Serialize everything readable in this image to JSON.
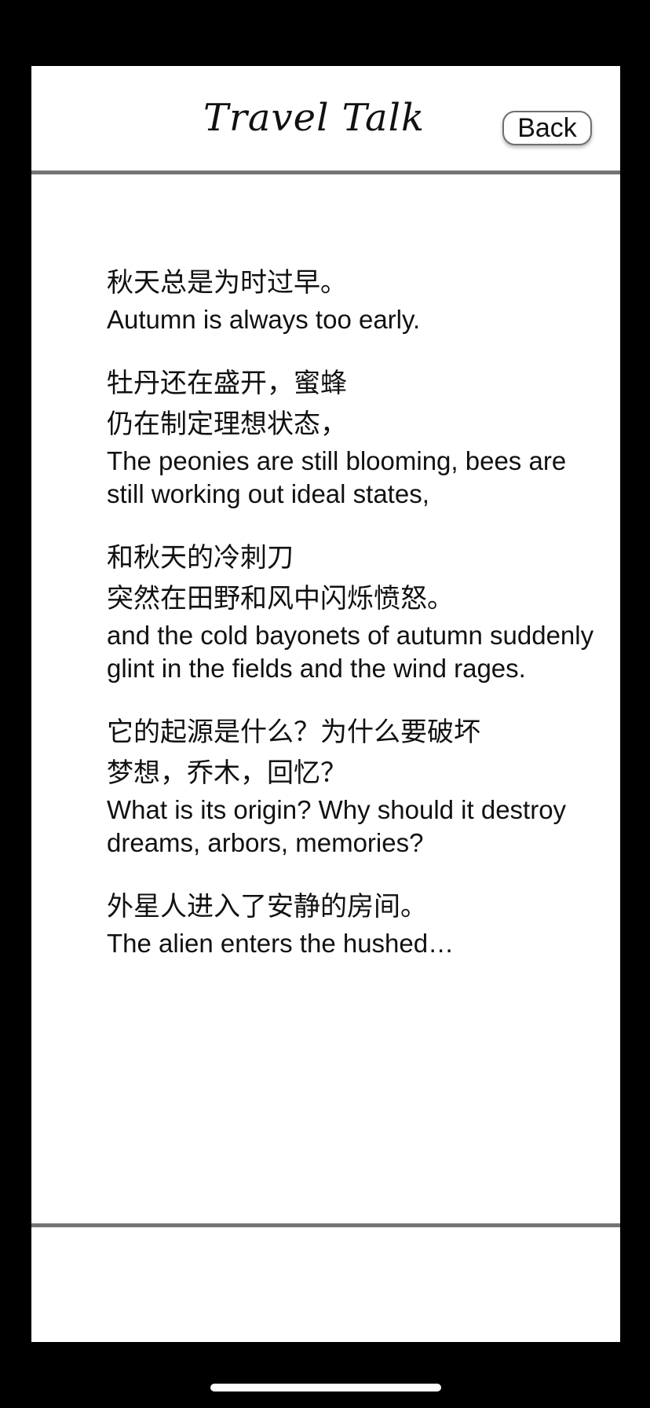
{
  "header": {
    "title": "Travel Talk",
    "back_label": "Back"
  },
  "poem": {
    "stanzas": [
      {
        "zh": [
          "秋天总是为时过早。"
        ],
        "en": "Autumn is always too early."
      },
      {
        "zh": [
          "牡丹还在盛开，蜜蜂",
          "仍在制定理想状态，"
        ],
        "en": "The peonies are still blooming, bees are still working out ideal states,"
      },
      {
        "zh": [
          "和秋天的冷刺刀",
          "突然在田野和风中闪烁愤怒。"
        ],
        "en": "and the cold bayonets of autumn suddenly glint in the fields and the wind rages."
      },
      {
        "zh": [
          "它的起源是什么？为什么要破坏",
          "梦想，乔木，回忆？"
        ],
        "en": "What is its origin? Why should it destroy dreams, arbors, memories?"
      },
      {
        "zh": [
          "外星人进入了安静的房间。"
        ],
        "en": "The alien enters the hushed…"
      }
    ]
  },
  "colors": {
    "background": "#000000",
    "panel": "#ffffff",
    "divider": "#747474",
    "text": "#111111"
  }
}
